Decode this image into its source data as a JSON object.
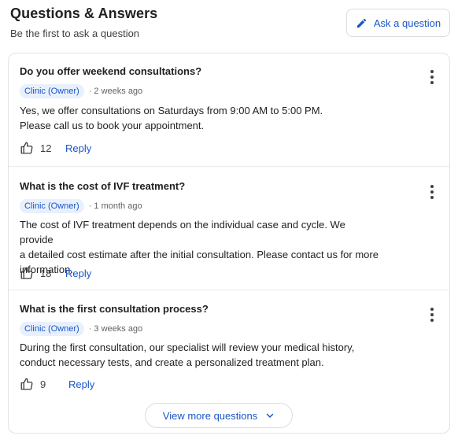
{
  "header": {
    "title": "Questions & Answers",
    "subtitle": "Be the first to ask a question",
    "ask_label": "Ask a question"
  },
  "questions": [
    {
      "question": "Do you offer weekend consultations?",
      "badge": "Clinic (Owner)",
      "time": "· 2 weeks ago",
      "answer_lines": [
        "Yes, we offer consultations on Saturdays from 9:00 AM to 5:00 PM.",
        "Please call us to book your appointment."
      ],
      "likes": "12",
      "reply_label": "Reply"
    },
    {
      "question": "What is the cost of IVF treatment?",
      "badge": "Clinic (Owner)",
      "time": "· 1 month ago",
      "answer_lines": [
        "The cost of IVF treatment depends on the individual case and cycle. We provide",
        "a detailed cost estimate after the initial consultation. Please contact us for more",
        "information."
      ],
      "likes": "18",
      "reply_label": "Reply"
    },
    {
      "question": "What is the first consultation process?",
      "badge": "Clinic (Owner)",
      "time": "· 3 weeks ago",
      "answer_lines": [
        "During the first consultation, our specialist will review your medical history,",
        "conduct necessary tests, and create a personalized treatment plan."
      ],
      "likes": "9",
      "reply_label": "Reply"
    }
  ],
  "footer": {
    "view_more_label": "View more questions"
  },
  "colors": {
    "accent": "#1a56c4",
    "badge_bg": "#e8f0fe",
    "border": "#dadce0"
  },
  "icons": [
    "pencil-icon",
    "thumbs-up-icon",
    "more-vert-icon",
    "chevron-down-icon"
  ]
}
